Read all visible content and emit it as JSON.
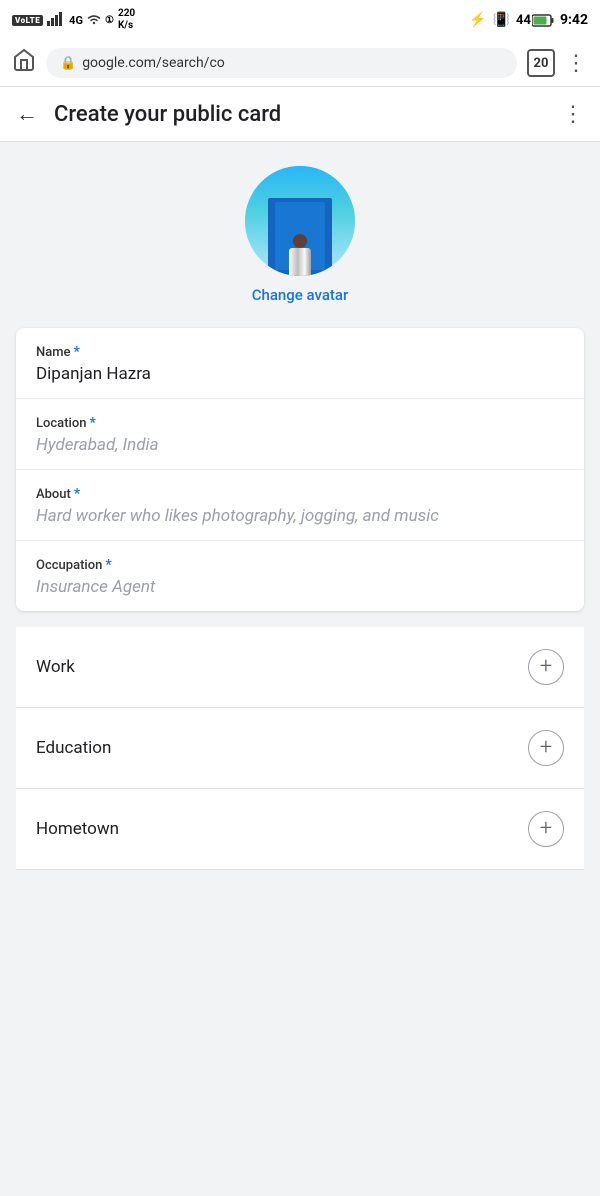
{
  "statusBar": {
    "left": {
      "volte": "VoLTE",
      "signal": "4G",
      "data": "220 K/s"
    },
    "right": {
      "bluetooth": "⚡",
      "battery": "44",
      "time": "9:42"
    }
  },
  "browserBar": {
    "url": "google.com/search/co",
    "tabCount": "20",
    "lockIcon": "🔒"
  },
  "pageHeader": {
    "title": "Create your public card",
    "backLabel": "←",
    "moreLabel": "⋮"
  },
  "avatarSection": {
    "changeAvatarLabel": "Change avatar"
  },
  "formCard": {
    "fields": [
      {
        "label": "Name",
        "required": true,
        "value": "Dipanjan Hazra",
        "placeholder": ""
      },
      {
        "label": "Location",
        "required": true,
        "value": "",
        "placeholder": "Hyderabad, India"
      },
      {
        "label": "About",
        "required": true,
        "value": "",
        "placeholder": "Hard worker who likes photography, jogging, and music"
      },
      {
        "label": "Occupation",
        "required": true,
        "value": "",
        "placeholder": "Insurance Agent"
      }
    ]
  },
  "expandSections": [
    {
      "label": "Work",
      "plusIcon": "+"
    },
    {
      "label": "Education",
      "plusIcon": "+"
    },
    {
      "label": "Hometown",
      "plusIcon": "+"
    }
  ]
}
